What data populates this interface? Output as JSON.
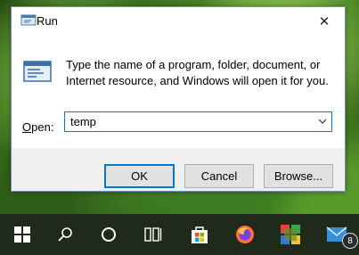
{
  "window": {
    "title": "Run",
    "close_glyph": "✕"
  },
  "dialog": {
    "description": "Type the name of a program, folder, document, or Internet resource, and Windows will open it for you.",
    "open_label_accel": "O",
    "open_label_rest": "pen:",
    "open_value": "temp"
  },
  "buttons": {
    "ok": "OK",
    "cancel": "Cancel",
    "browse": "Browse..."
  },
  "taskbar": {
    "items": [
      "windows-start-icon",
      "search-icon",
      "cortana-icon",
      "task-view-icon",
      "microsoft-store-icon",
      "firefox-icon",
      "office-apps-icon",
      "mail-icon"
    ],
    "mail_badge": "8"
  },
  "colors": {
    "accent": "#0078d7",
    "dialog_bg": "#f0f0f0",
    "taskbar": "#1f2a1a"
  }
}
